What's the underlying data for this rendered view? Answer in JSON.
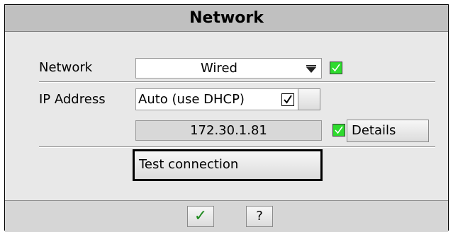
{
  "dialog": {
    "title": "Network"
  },
  "network_row": {
    "label": "Network",
    "selected": "Wired",
    "enabled": true
  },
  "ip_row": {
    "label": "IP Address",
    "mode_label": "Auto (use DHCP)",
    "dhcp_checked": true,
    "address": "172.30.1.81",
    "details_checked": true,
    "details_label": "Details"
  },
  "test_button": {
    "label": "Test connection"
  },
  "footer": {
    "ok_label": "✓",
    "help_label": "?"
  },
  "colors": {
    "check_green": "#2edb2e",
    "ok_green": "#1e8a1e"
  },
  "icons": {
    "dropdown": "chevron-down-icon",
    "check": "check-icon"
  }
}
